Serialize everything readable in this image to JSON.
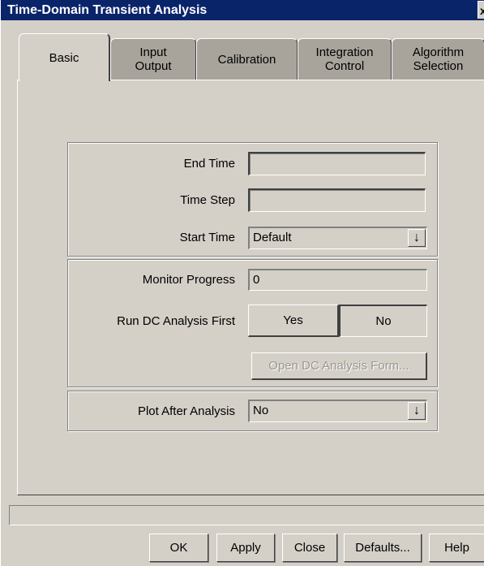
{
  "window": {
    "title": "Time-Domain Transient Analysis",
    "close_glyph": "x"
  },
  "tabs": [
    {
      "line1": "Basic",
      "line2": ""
    },
    {
      "line1": "Input",
      "line2": "Output"
    },
    {
      "line1": "Calibration",
      "line2": ""
    },
    {
      "line1": "Integration",
      "line2": "Control"
    },
    {
      "line1": "Algorithm",
      "line2": "Selection"
    }
  ],
  "active_tab": "Basic",
  "time_group": {
    "end_time_label": "End Time",
    "end_time_value": "",
    "time_step_label": "Time Step",
    "time_step_value": "",
    "start_time_label": "Start Time",
    "start_time_value": "Default"
  },
  "monitor_group": {
    "monitor_progress_label": "Monitor Progress",
    "monitor_progress_value": "0",
    "run_dc_label": "Run DC Analysis First",
    "yes_label": "Yes",
    "no_label": "No",
    "selected": "No",
    "open_dc_label": "Open DC Analysis Form..."
  },
  "plot_group": {
    "plot_after_label": "Plot After Analysis",
    "plot_after_value": "No"
  },
  "combo_arrow_glyph": "↓",
  "status_text": "",
  "footer": {
    "ok": "OK",
    "apply": "Apply",
    "close": "Close",
    "defaults": "Defaults...",
    "help": "Help"
  }
}
